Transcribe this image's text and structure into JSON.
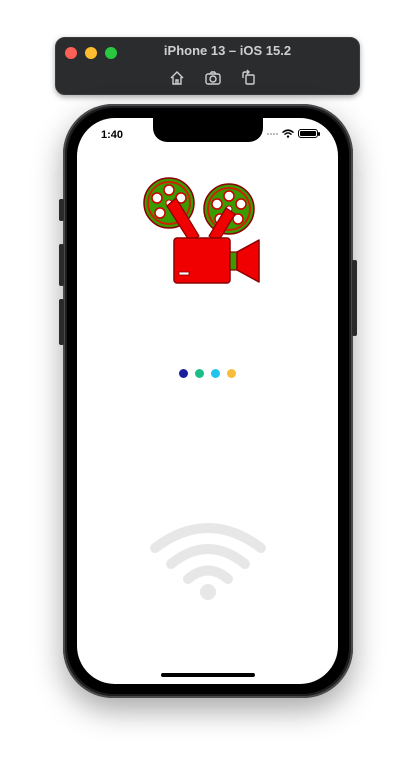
{
  "simulator": {
    "title": "iPhone 13 – iOS 15.2",
    "buttons": [
      "home-icon",
      "screenshot-icon",
      "rotate-icon"
    ]
  },
  "status_bar": {
    "time": "1:40"
  },
  "app": {
    "logo": "movie-camera-logo",
    "loading_dots": [
      "#1a1d9c",
      "#1dbd8a",
      "#20c4ef",
      "#f9bc3a"
    ],
    "offline_icon": "wifi-icon",
    "colors": {
      "camera_red": "#f00000",
      "reel_green": "#3a9a00",
      "wifi_gray": "#e7e7e7"
    }
  }
}
